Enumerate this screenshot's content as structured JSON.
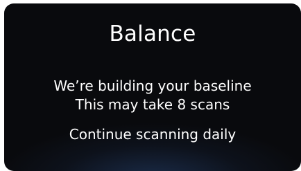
{
  "card": {
    "title": "Balance",
    "message_line_1": "We’re building your baseline",
    "message_line_2": "This may take 8 scans",
    "message_line_3": "Continue scanning daily"
  },
  "colors": {
    "background": "#090a0d",
    "text": "#ffffff",
    "glow": "#284678"
  }
}
